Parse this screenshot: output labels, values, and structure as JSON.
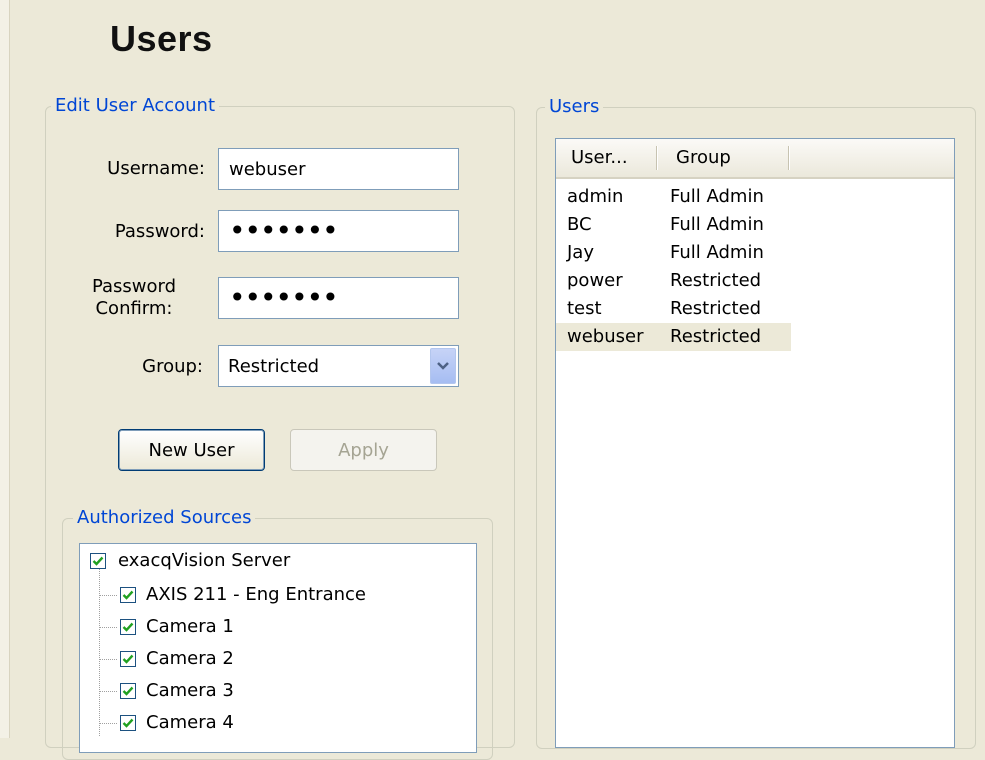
{
  "page": {
    "title": "Users"
  },
  "edit_account": {
    "legend": "Edit User Account",
    "username_label": "Username:",
    "username_value": "webuser",
    "password_label": "Password:",
    "password_value": "•••••••",
    "confirm_label_1": "Password",
    "confirm_label_2": "Confirm:",
    "confirm_value": "•••••••",
    "group_label": "Group:",
    "group_value": "Restricted",
    "new_user_label": "New User",
    "apply_label": "Apply"
  },
  "authorized_sources": {
    "legend": "Authorized Sources",
    "root": {
      "label": "exacqVision Server",
      "checked": true
    },
    "items": [
      {
        "label": "AXIS 211 - Eng Entrance",
        "checked": true
      },
      {
        "label": "Camera 1",
        "checked": true
      },
      {
        "label": "Camera 2",
        "checked": true
      },
      {
        "label": "Camera 3",
        "checked": true
      },
      {
        "label": "Camera 4",
        "checked": true
      }
    ]
  },
  "users_panel": {
    "legend": "Users",
    "columns": [
      "User...",
      "Group"
    ],
    "rows": [
      {
        "user": "admin",
        "group": "Full Admin"
      },
      {
        "user": "BC",
        "group": "Full Admin"
      },
      {
        "user": "Jay",
        "group": "Full Admin"
      },
      {
        "user": "power",
        "group": "Restricted"
      },
      {
        "user": "test",
        "group": "Restricted"
      },
      {
        "user": "webuser",
        "group": "Restricted",
        "selected": true
      }
    ]
  },
  "colors": {
    "legend": "#0046d5",
    "background": "#ece9d8",
    "border": "#7f9db9"
  }
}
